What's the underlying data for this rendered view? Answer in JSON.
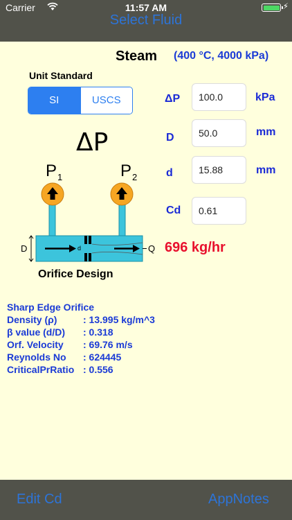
{
  "status_bar": {
    "carrier": "Carrier",
    "time": "11:57 AM"
  },
  "nav": {
    "title": "Select Fluid"
  },
  "fluid": {
    "name": "Steam",
    "conditions": "(400 °C, 4000 kPa)"
  },
  "unit_standard": {
    "label": "Unit Standard",
    "options": [
      "SI",
      "USCS"
    ],
    "selected": "SI"
  },
  "diagram": {
    "title": "ΔP",
    "p1": "P",
    "p1_sub": "1",
    "p2": "P",
    "p2_sub": "2",
    "d_outer": "D",
    "d_inner": "d",
    "q": "Q",
    "caption": "Orifice Design"
  },
  "fields": {
    "dp": {
      "label": "ΔP",
      "value": "100.0",
      "unit": "kPa"
    },
    "D": {
      "label": "D",
      "value": "50.0",
      "unit": "mm"
    },
    "d": {
      "label": "d",
      "value": "15.88",
      "unit": "mm"
    },
    "cd": {
      "label": "Cd",
      "value": "0.61"
    }
  },
  "result": "696 kg/hr",
  "info": {
    "title": "Sharp Edge Orifice",
    "rows": [
      {
        "key": "Density (ρ)",
        "value": ": 13.995 kg/m^3"
      },
      {
        "key": "β value (d/D)",
        "value": ": 0.318"
      },
      {
        "key": "Orf. Velocity",
        "value": ": 69.76 m/s"
      },
      {
        "key": "Reynolds No",
        "value": ": 624445"
      },
      {
        "key": "CriticalPrRatio",
        "value": ": 0.556"
      }
    ]
  },
  "toolbar": {
    "left": "Edit Cd",
    "right": "AppNotes"
  },
  "colors": {
    "accent": "#2d7ff0",
    "label_blue": "#1a2ad6",
    "result_red": "#e8102d",
    "background": "#ffffdd",
    "bar": "#51524a"
  }
}
